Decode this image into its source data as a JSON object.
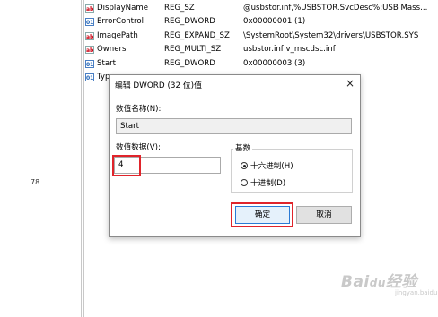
{
  "side_number": "78",
  "registry_values": [
    {
      "icon": "ab",
      "name": "DisplayName",
      "type": "REG_SZ",
      "data": "@usbstor.inf,%USBSTOR.SvcDesc%;USB Mass..."
    },
    {
      "icon": "bin",
      "name": "ErrorControl",
      "type": "REG_DWORD",
      "data": "0x00000001 (1)"
    },
    {
      "icon": "ab",
      "name": "ImagePath",
      "type": "REG_EXPAND_SZ",
      "data": "\\SystemRoot\\System32\\drivers\\USBSTOR.SYS"
    },
    {
      "icon": "ab",
      "name": "Owners",
      "type": "REG_MULTI_SZ",
      "data": "usbstor.inf v_mscdsc.inf"
    },
    {
      "icon": "bin",
      "name": "Start",
      "type": "REG_DWORD",
      "data": "0x00000003 (3)"
    },
    {
      "icon": "bin",
      "name": "Typ",
      "type": "",
      "data": ""
    }
  ],
  "dialog": {
    "title": "编辑 DWORD (32 位)值",
    "close_glyph": "×",
    "value_name_label": "数值名称(N):",
    "value_name": "Start",
    "value_data_label": "数值数据(V):",
    "value_data": "4",
    "base_label": "基数",
    "hex_label": "十六进制(H)",
    "dec_label": "十进制(D)",
    "selected_base": "hex",
    "ok_label": "确定",
    "cancel_label": "取消"
  },
  "watermark": {
    "text": "Baidu经验",
    "sub": "jingyan.baidu.com"
  },
  "colors": {
    "highlight": "#e0242b",
    "dialog_border": "#8a8a8a"
  }
}
